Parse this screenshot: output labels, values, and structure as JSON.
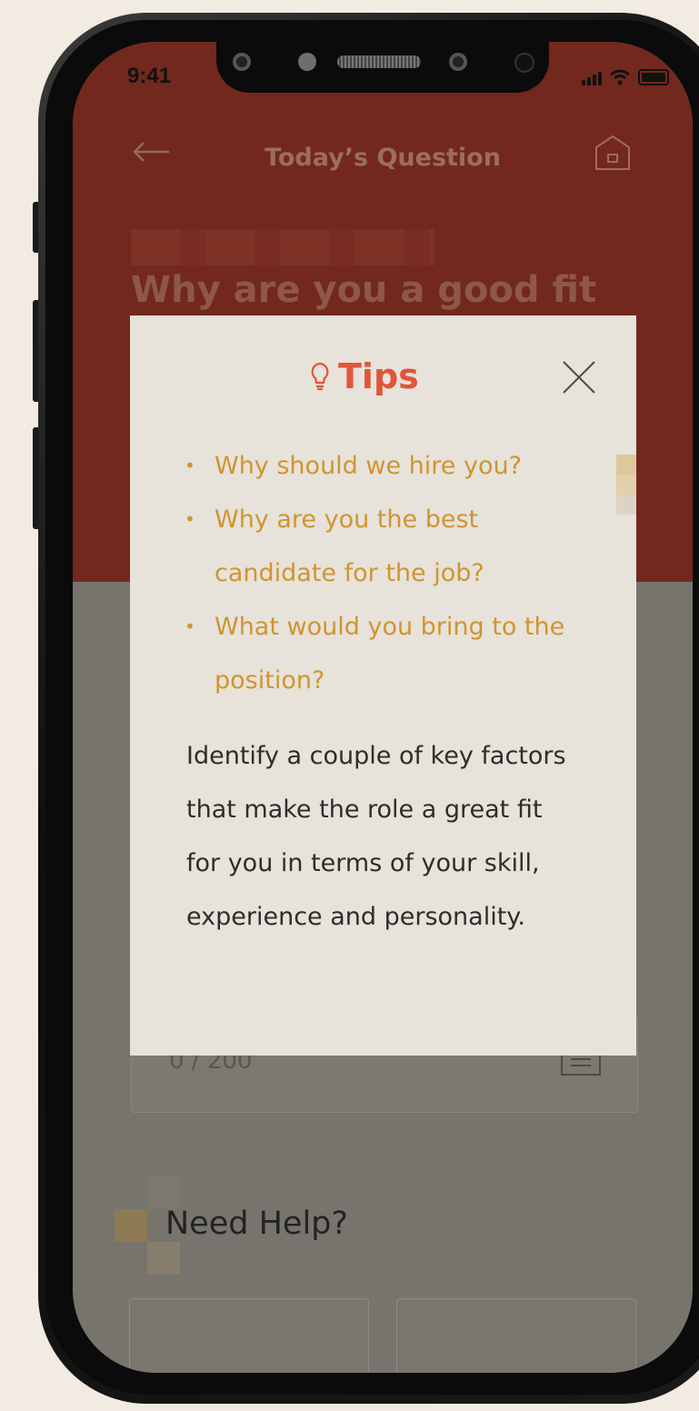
{
  "status_bar": {
    "time": "9:41"
  },
  "header": {
    "title": "Today’s Question",
    "back_icon": "arrow-left-icon",
    "home_icon": "home-icon"
  },
  "question": {
    "title": "Why are you a good fit"
  },
  "answer": {
    "counter": "0 / 200",
    "icon": "notes-icon"
  },
  "help": {
    "title": "Need Help?"
  },
  "modal": {
    "title": "Tips",
    "title_icon": "lightbulb-icon",
    "close_icon": "close-icon",
    "bullets": [
      "Why should we hire you?",
      "Why are you the best candidate for the job?",
      "What would you bring to the position?"
    ],
    "body": "Identify a couple of key factors that make the role a great fit for you in terms of your skill, experience and personality."
  },
  "colors": {
    "accent": "#e0563a",
    "tips_text": "#cf9530",
    "hero": "#73281d",
    "modal_bg": "#e7e2da",
    "page_bg": "#f1ebe1"
  }
}
